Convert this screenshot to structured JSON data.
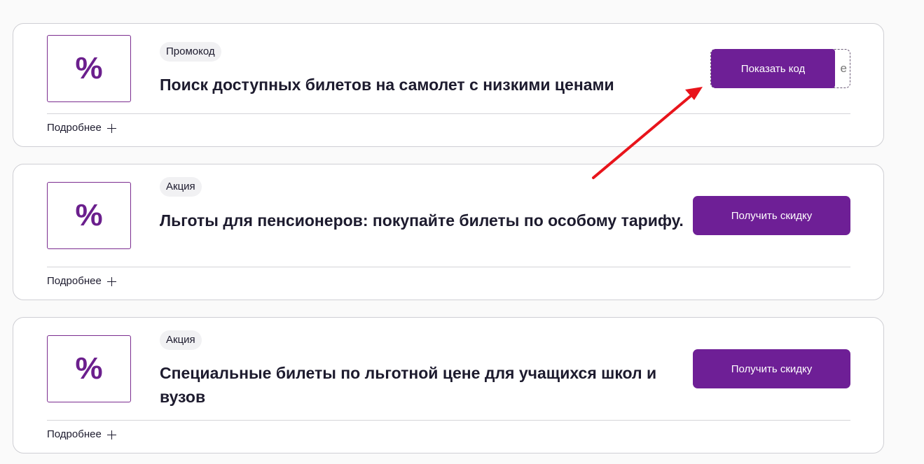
{
  "offers": [
    {
      "logo_symbol": "%",
      "badge": "Промокод",
      "title": "Поиск доступных билетов на самолет с низкими ценами",
      "button": "Показать код",
      "code_peek": "е",
      "more": "Подробнее"
    },
    {
      "logo_symbol": "%",
      "badge": "Акция",
      "title": "Льготы для пенсионеров: покупайте билеты по особому тарифу.",
      "button": "Получить скидку",
      "more": "Подробнее"
    },
    {
      "logo_symbol": "%",
      "badge": "Акция",
      "title": "Специальные билеты по льготной цене для учащихся школ и вузов",
      "button": "Получить скидку",
      "more": "Подробнее"
    }
  ],
  "colors": {
    "accent": "#6e1f96",
    "annotation_arrow": "#e8141b"
  },
  "icons": {
    "more": "plus-icon",
    "annotation": "red-arrow-icon"
  }
}
